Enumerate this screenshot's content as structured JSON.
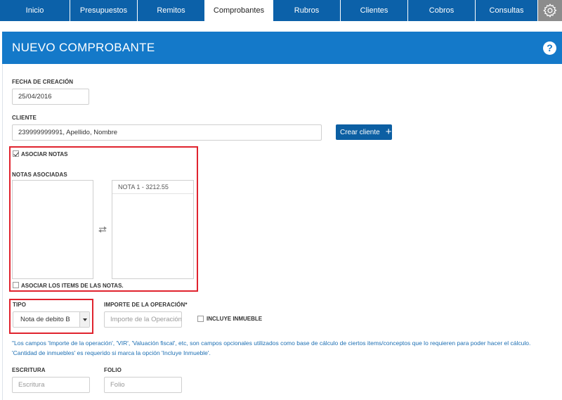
{
  "nav": {
    "tabs": [
      {
        "label": "Inicio"
      },
      {
        "label": "Presupuestos"
      },
      {
        "label": "Remitos"
      },
      {
        "label": "Comprobantes"
      },
      {
        "label": "Rubros"
      },
      {
        "label": "Clientes"
      },
      {
        "label": "Cobros"
      },
      {
        "label": "Consultas"
      }
    ],
    "active_tab": "Comprobantes",
    "settings_icon": "gear-icon"
  },
  "header": {
    "title": "NUEVO COMPROBANTE",
    "help_icon": "question-icon",
    "color": "#1479c9"
  },
  "form": {
    "fecha": {
      "label": "FECHA DE CREACIÓN",
      "value": "25/04/2016"
    },
    "cliente": {
      "label": "CLIENTE",
      "value": "239999999991, Apellido, Nombre"
    },
    "crear_cliente": {
      "label": "Crear cliente",
      "icon": "plus-icon"
    },
    "asociar_notas": {
      "label": "ASOCIAR NOTAS",
      "checked": true
    },
    "notas_asociadas": {
      "label": "NOTAS ASOCIADAS",
      "available": [],
      "selected": [
        "NOTA 1 - 3212.55"
      ],
      "swap_icon": "swap-arrows-icon"
    },
    "asociar_items": {
      "label": "ASOCIAR LOS ITEMS DE LAS NOTAS.",
      "checked": false
    },
    "tipo": {
      "label": "TIPO",
      "value": "Nota de debito B"
    },
    "importe": {
      "label": "IMPORTE DE LA OPERACIÓN*",
      "placeholder": "Importe de la Operación"
    },
    "incluye_inmueble": {
      "label": "INCLUYE INMUEBLE",
      "checked": false
    },
    "note": "\"Los campos 'Importe de la operación', 'VIR', 'Valuación fiscal', etc, son campos opcionales utilizados como base de cálculo de ciertos items/conceptos que lo requieren para poder hacer el cálculo. 'Cantidad de inmuebles' es requerido si marca la opción 'Incluye Inmueble'.",
    "escritura": {
      "label": "ESCRITURA",
      "placeholder": "Escritura"
    },
    "folio": {
      "label": "FOLIO",
      "placeholder": "Folio"
    }
  },
  "colors": {
    "nav": "#0c61a9",
    "highlight": "#e0232e",
    "button": "#0c5fa3",
    "note_text": "#1d6fb3"
  }
}
